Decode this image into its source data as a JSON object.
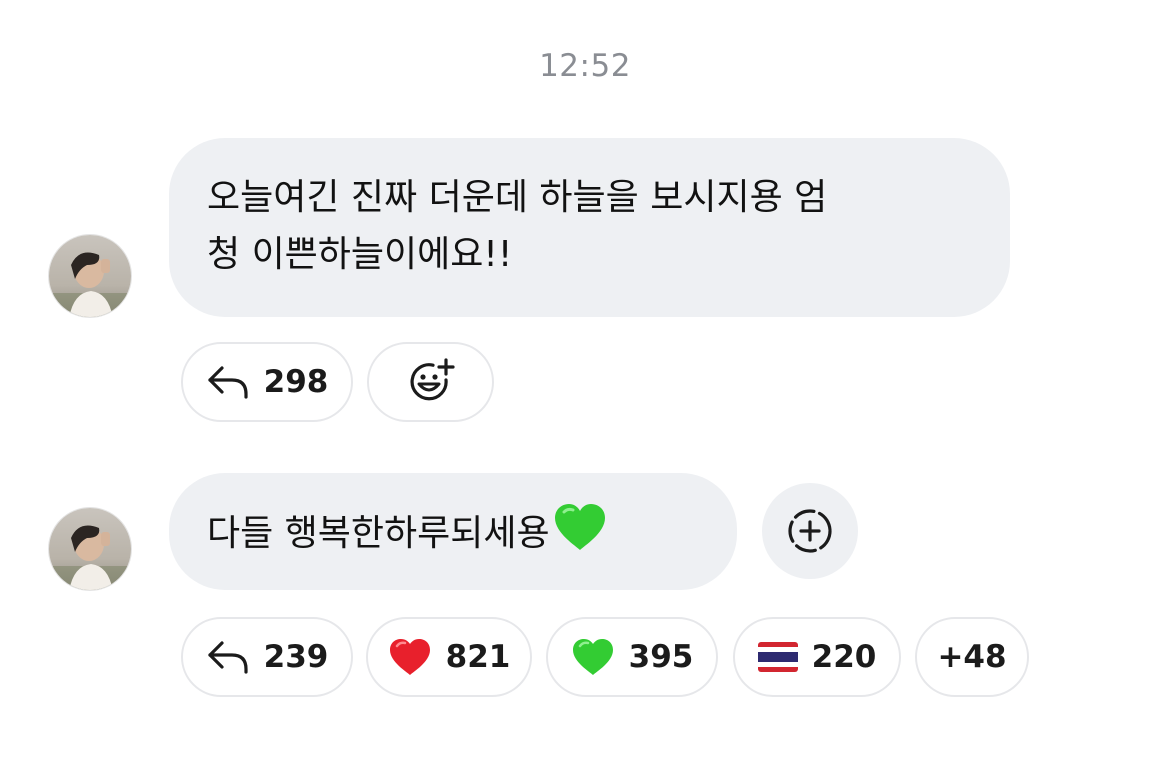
{
  "timestamp": "12:52",
  "messages": [
    {
      "text_line1": "오늘여긴 진짜 더운데 하늘을 보시지용 엄",
      "text_line2": "청 이쁜하늘이에요!!",
      "reply_count": "298",
      "reactions": []
    },
    {
      "text": "다들 행복한하루되세용",
      "trailing_emoji": "green-heart",
      "reply_count": "239",
      "reactions": [
        {
          "emoji": "red-heart",
          "count": "821"
        },
        {
          "emoji": "green-heart",
          "count": "395"
        },
        {
          "emoji": "thailand-flag",
          "count": "220"
        }
      ],
      "more_reactions": "+48"
    }
  ],
  "colors": {
    "bubble": "#eef0f3",
    "pill_border": "#e6e7ea",
    "timestamp": "#8a8d93",
    "red_heart": "#e8202c",
    "green_heart": "#33cc33"
  }
}
